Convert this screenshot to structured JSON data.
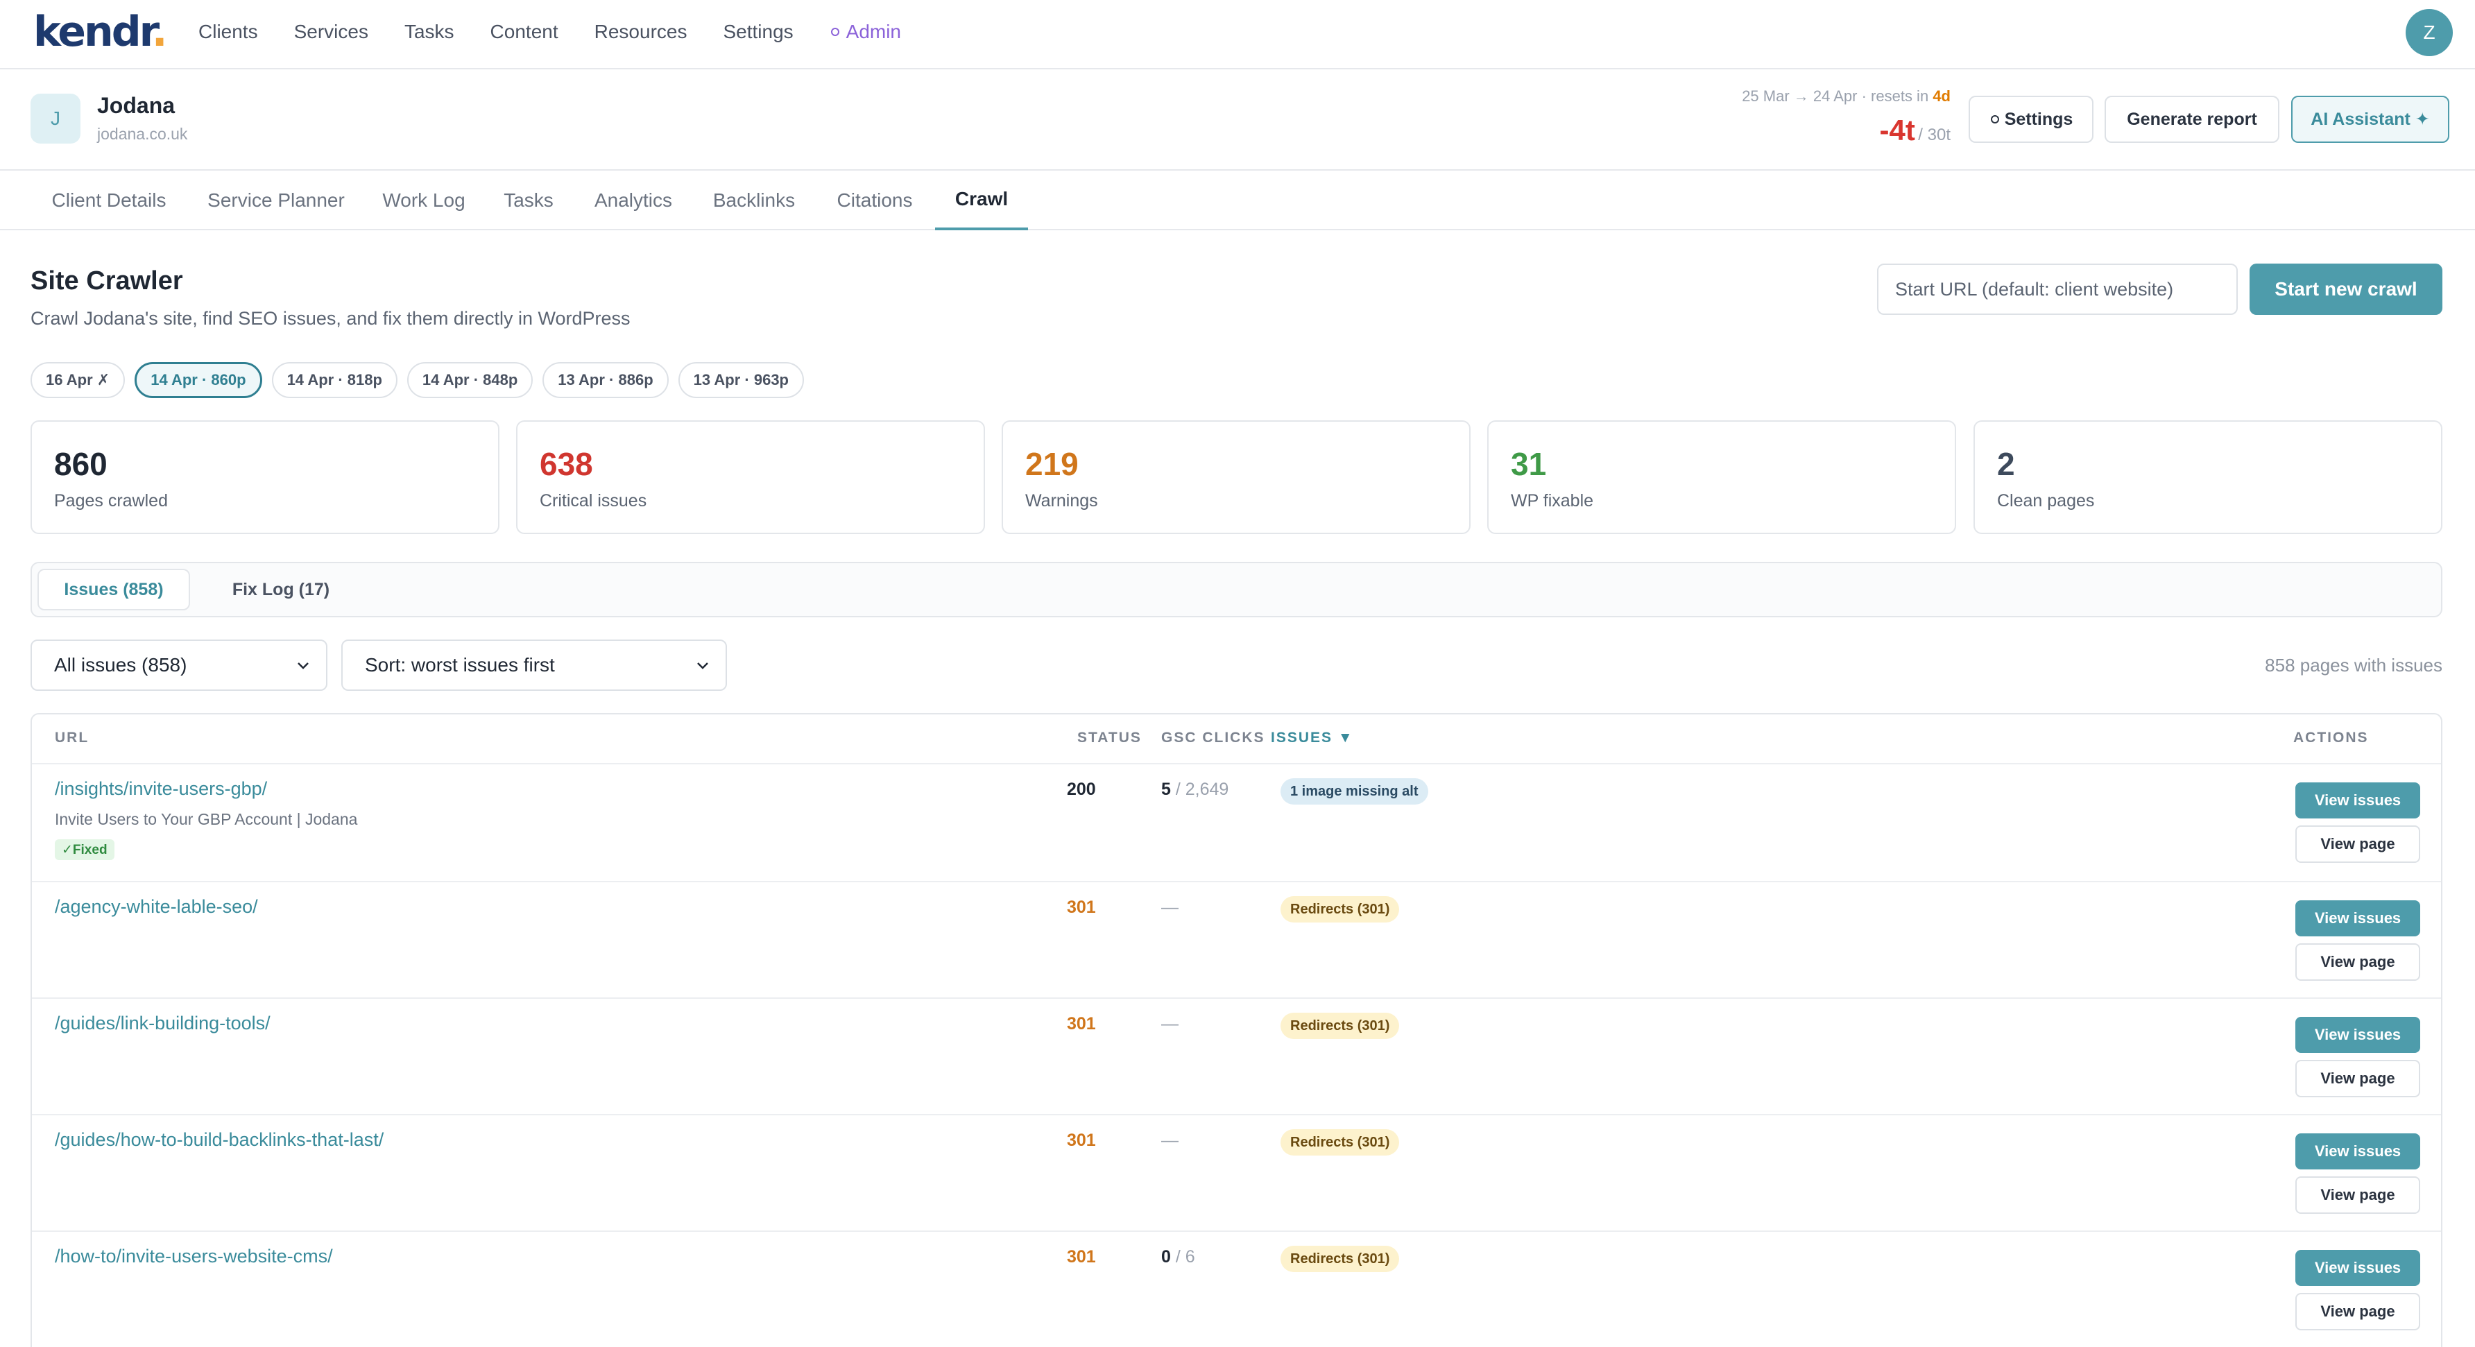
{
  "brand": {
    "logo_main": "kendr",
    "logo_dot": ".",
    "accent_color": "#4e9cab"
  },
  "nav": {
    "items": [
      "Clients",
      "Services",
      "Tasks",
      "Content",
      "Resources",
      "Settings"
    ],
    "admin_label": "Admin",
    "admin_icon": "gear-icon",
    "user_initial": "Z"
  },
  "client": {
    "initial": "J",
    "name": "Jodana",
    "domain": "jodana.co.uk",
    "period": "25 Mar → 24 Apr · resets in",
    "resets_in": "4d",
    "credits_value": "-4t",
    "credits_total": "/ 30t",
    "settings_label": "Settings",
    "report_label": "Generate report",
    "ai_label": "AI Assistant ✦"
  },
  "tabs": [
    "Client Details",
    "Service Planner",
    "Work Log",
    "Tasks",
    "Analytics",
    "Backlinks",
    "Citations",
    "Crawl"
  ],
  "active_tab": "Crawl",
  "crawler": {
    "title": "Site Crawler",
    "subtitle": "Crawl Jodana's site, find SEO issues, and fix them directly in WordPress",
    "url_placeholder": "Start URL (default: client website)",
    "start_label": "Start new crawl"
  },
  "crawl_history": [
    {
      "label": "16 Apr ✗",
      "active": false
    },
    {
      "label": "14 Apr · 860p",
      "active": true
    },
    {
      "label": "14 Apr · 818p",
      "active": false
    },
    {
      "label": "14 Apr · 848p",
      "active": false
    },
    {
      "label": "13 Apr · 886p",
      "active": false
    },
    {
      "label": "13 Apr · 963p",
      "active": false
    }
  ],
  "stats": [
    {
      "value": "860",
      "label": "Pages crawled",
      "color": "#1f2733"
    },
    {
      "value": "638",
      "label": "Critical issues",
      "color": "#d0362f"
    },
    {
      "value": "219",
      "label": "Warnings",
      "color": "#d0761b"
    },
    {
      "value": "31",
      "label": "WP fixable",
      "color": "#3f9a47"
    },
    {
      "value": "2",
      "label": "Clean pages",
      "color": "#3d4a5c"
    }
  ],
  "subtabs": {
    "issues": "Issues (858)",
    "fixlog": "Fix Log (17)"
  },
  "filters": {
    "issue_filter": "All issues (858)",
    "sort": "Sort: worst issues first",
    "pages_with_issues": "858 pages with issues"
  },
  "table": {
    "headers": {
      "url": "URL",
      "status": "STATUS",
      "gsc": "GSC CLICKS",
      "issues": "ISSUES ▼",
      "actions": "ACTIONS"
    },
    "view_issues_label": "View issues",
    "view_page_label": "View page",
    "rows": [
      {
        "url": "/insights/invite-users-gbp/",
        "title": "Invite Users to Your GBP Account | Jodana",
        "fixed": "✓Fixed",
        "status": "200",
        "status_kind": "ok",
        "gsc_clicks": "5",
        "gsc_impr": "/ 2,649",
        "issue": "1 image missing alt",
        "issue_kind": "blue"
      },
      {
        "url": "/agency-white-lable-seo/",
        "title": "",
        "fixed": "",
        "status": "301",
        "status_kind": "redir",
        "gsc_clicks": "",
        "gsc_impr": "—",
        "issue": "Redirects (301)",
        "issue_kind": "yellow"
      },
      {
        "url": "/guides/link-building-tools/",
        "title": "",
        "fixed": "",
        "status": "301",
        "status_kind": "redir",
        "gsc_clicks": "",
        "gsc_impr": "—",
        "issue": "Redirects (301)",
        "issue_kind": "yellow"
      },
      {
        "url": "/guides/how-to-build-backlinks-that-last/",
        "title": "",
        "fixed": "",
        "status": "301",
        "status_kind": "redir",
        "gsc_clicks": "",
        "gsc_impr": "—",
        "issue": "Redirects (301)",
        "issue_kind": "yellow"
      },
      {
        "url": "/how-to/invite-users-website-cms/",
        "title": "",
        "fixed": "",
        "status": "301",
        "status_kind": "redir",
        "gsc_clicks": "0",
        "gsc_impr": "/ 6",
        "issue": "Redirects (301)",
        "issue_kind": "yellow"
      }
    ]
  }
}
